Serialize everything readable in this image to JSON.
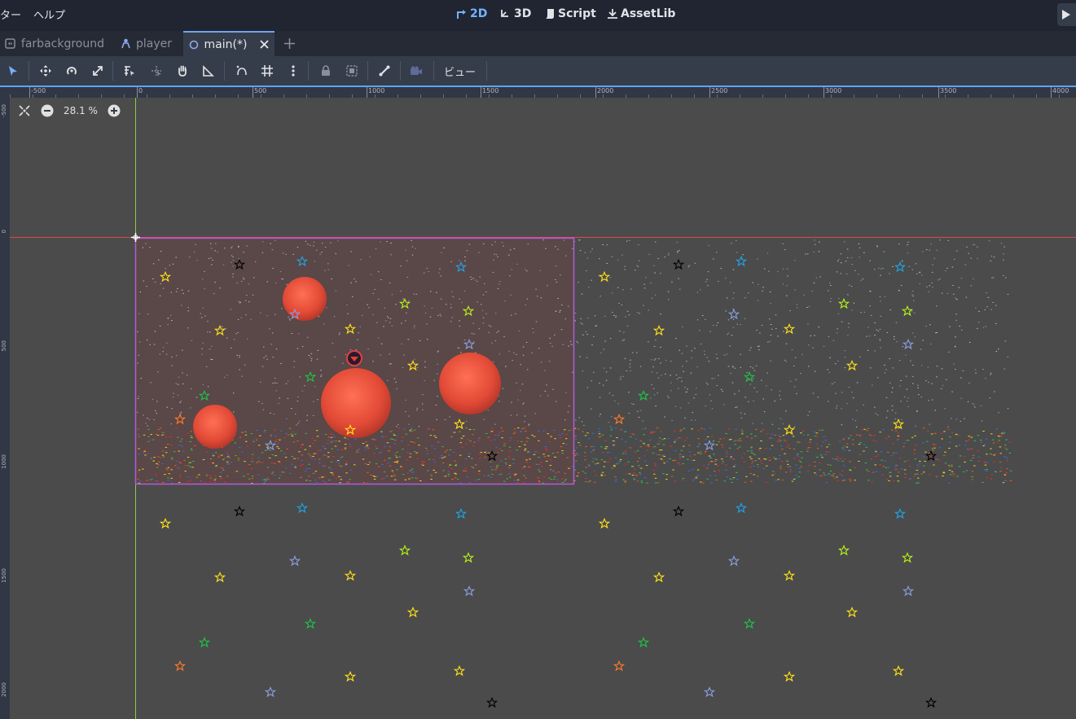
{
  "menu": {
    "scene_partial": "ター",
    "help": "ヘルプ"
  },
  "workspaces": {
    "w2d": "2D",
    "w3d": "3D",
    "script": "Script",
    "assetlib": "AssetLib"
  },
  "tabs": {
    "farbackground": "farbackground",
    "player": "player",
    "main": "main(*)"
  },
  "toolbar": {
    "view": "ビュー"
  },
  "zoom": {
    "level": "28.1 %"
  },
  "ruler": {
    "top_labels": [
      "-500",
      "0",
      "500",
      "1000",
      "1500",
      "2000",
      "2500",
      "3000",
      "3500",
      "4000"
    ],
    "left_labels": [
      "-500",
      "0",
      "500",
      "1000",
      "1500",
      "2000"
    ]
  },
  "colors": {
    "accent": "#74b2ff",
    "origin_x_axis": "#e0474a",
    "origin_y_axis": "#8fc94a",
    "camera_rect": "#b45ad9",
    "moon": "#e6503d"
  },
  "scene": {
    "stars": [
      {
        "c": "#000000"
      },
      {
        "c": "#1fa3e6"
      },
      {
        "c": "#1fa3e6"
      },
      {
        "c": "#ffe21a"
      },
      {
        "c": "#8a9fe0"
      },
      {
        "c": "#b8f21a"
      },
      {
        "c": "#b8f21a"
      },
      {
        "c": "#ffe21a"
      },
      {
        "c": "#ffe21a"
      },
      {
        "c": "#8a9fe0"
      },
      {
        "c": "#ffe21a"
      },
      {
        "c": "#1fc24a"
      },
      {
        "c": "#1fc24a"
      },
      {
        "c": "#ff7a2a"
      },
      {
        "c": "#ffe21a"
      },
      {
        "c": "#ffe21a"
      },
      {
        "c": "#8a9fe0"
      },
      {
        "c": "#000000"
      }
    ]
  }
}
